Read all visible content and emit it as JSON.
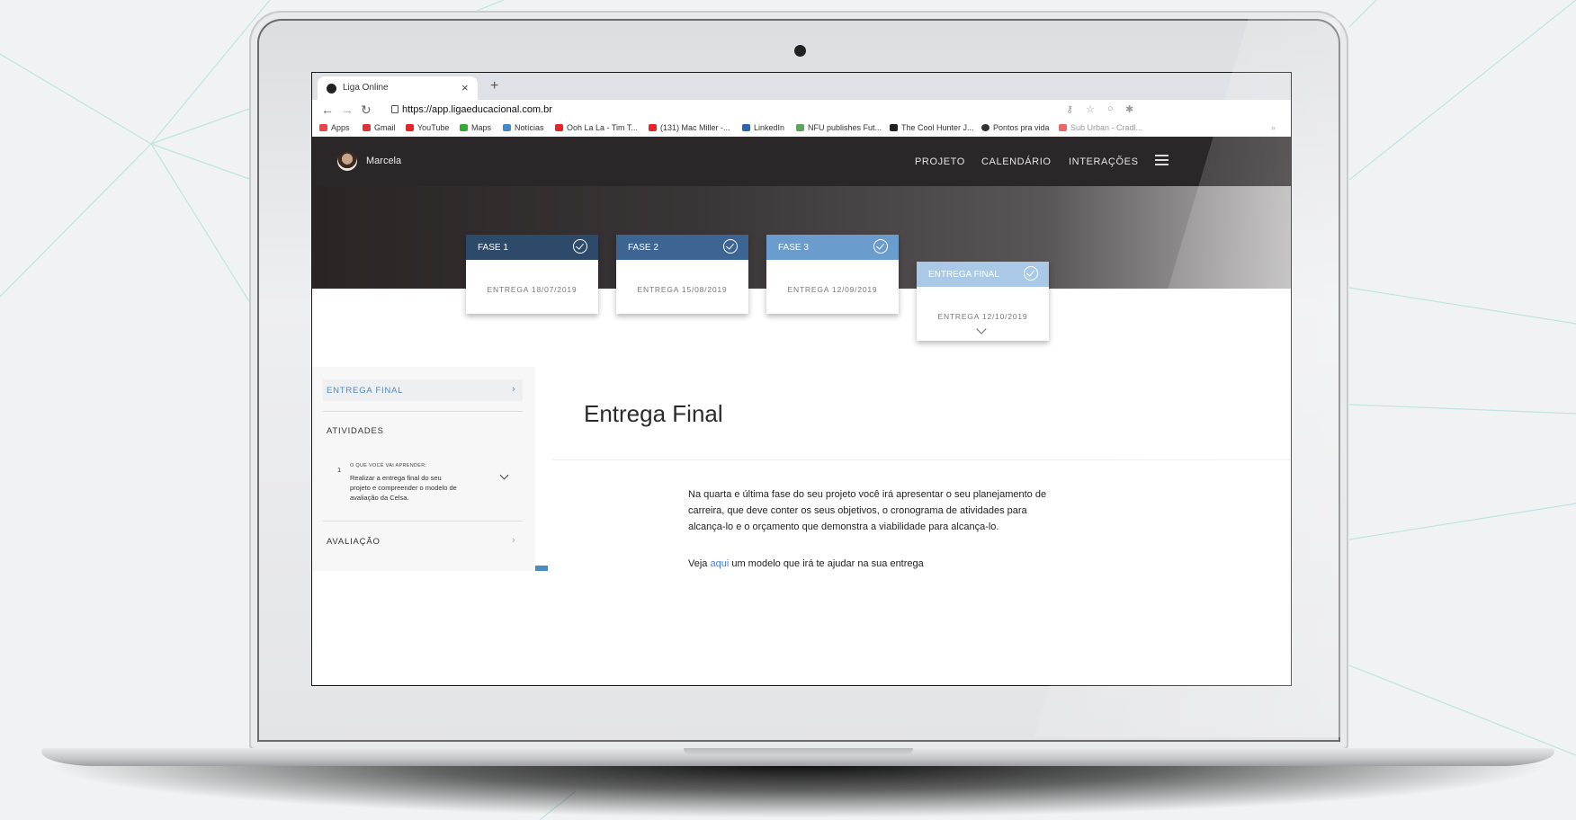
{
  "browser": {
    "tab_title": "Liga Online",
    "tab_close": "×",
    "new_tab": "+",
    "url": "https://app.ligaeducacional.com.br",
    "bookmarks": [
      {
        "label": "Apps"
      },
      {
        "label": "Gmail"
      },
      {
        "label": "YouTube"
      },
      {
        "label": "Maps"
      },
      {
        "label": "Notícias"
      },
      {
        "label": "Ooh La La - Tim T..."
      },
      {
        "label": "(131) Mac Miller -..."
      },
      {
        "label": "LinkedIn"
      },
      {
        "label": "NFU publishes Fut..."
      },
      {
        "label": "The Cool Hunter J..."
      },
      {
        "label": "Pontos pra vida"
      },
      {
        "label": "Sub Urban - Cradl..."
      }
    ],
    "more": "»"
  },
  "header": {
    "user_name": "Marcela",
    "nav": [
      {
        "label": "PROJETO"
      },
      {
        "label": "CALENDÁRIO"
      },
      {
        "label": "INTERAÇÕES"
      }
    ]
  },
  "phases": [
    {
      "title": "FASE 1",
      "date": "ENTREGA 18/07/2019",
      "color": "#2d4a6b"
    },
    {
      "title": "FASE 2",
      "date": "ENTREGA 15/08/2019",
      "color": "#3d6594"
    },
    {
      "title": "FASE 3",
      "date": "ENTREGA 12/09/2019",
      "color": "#6a9ccd"
    },
    {
      "title": "ENTREGA FINAL",
      "date": "ENTREGA 12/10/2019",
      "color": "#a9c9e6"
    }
  ],
  "sidebar": {
    "final_label": "ENTREGA FINAL",
    "atividades_heading": "ATIVIDADES",
    "activity": {
      "number": "1",
      "kicker": "O QUE VOCÊ VAI APRENDER:",
      "text": "Realizar a entrega final do seu projeto e compreender o modelo de avaliação da Celsa."
    },
    "avaliacao_label": "AVALIAÇÃO"
  },
  "main": {
    "title": "Entrega Final",
    "paragraph": "Na quarta e última fase do seu projeto você irá apresentar o seu planejamento de carreira, que deve conter os seus objetivos, o cronograma de atividades para alcança-lo e o orçamento que demonstra a viabilidade para alcança-lo.",
    "link_prefix": "Veja",
    "link_text": "aqui",
    "link_suffix": "um modelo que irá te ajudar na sua entrega"
  }
}
